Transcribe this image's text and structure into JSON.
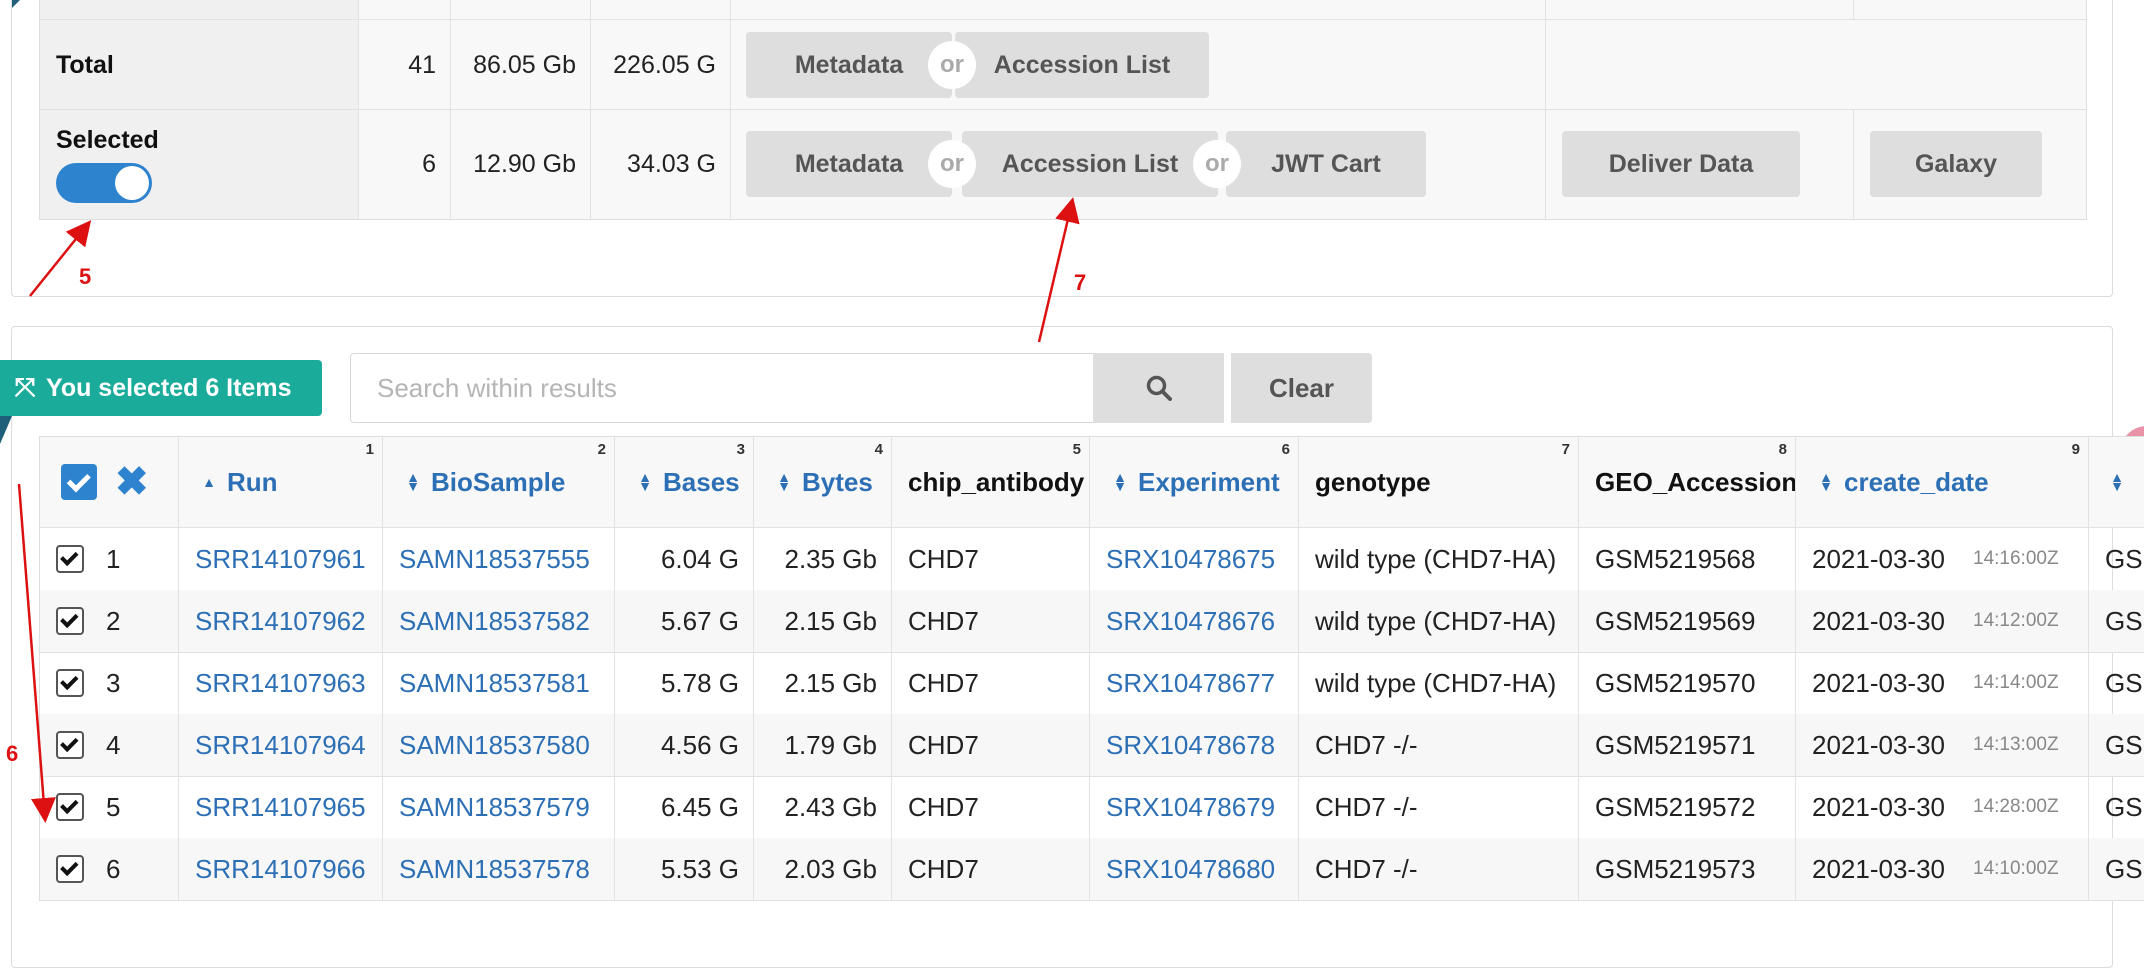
{
  "summary": {
    "total": {
      "label": "Total",
      "runs": "41",
      "bases": "86.05 Gb",
      "bytes": "226.05 G",
      "btn_metadata": "Metadata",
      "or1": "or",
      "btn_accession": "Accession List"
    },
    "selected": {
      "label": "Selected",
      "runs": "6",
      "bases": "12.90 Gb",
      "bytes": "34.03 G",
      "btn_metadata": "Metadata",
      "or1": "or",
      "btn_accession": "Accession List",
      "or2": "or",
      "btn_jwt": "JWT Cart",
      "btn_deliver": "Deliver Data",
      "btn_galaxy": "Galaxy",
      "toggle_on": true
    }
  },
  "annotations": {
    "a5": "5",
    "a6": "6",
    "a7": "7"
  },
  "toolbar": {
    "selected_badge": "You selected 6 Items",
    "search_placeholder": "Search within results",
    "clear_label": "Clear"
  },
  "table": {
    "headers": [
      {
        "label": "Run",
        "num": "1"
      },
      {
        "label": "BioSample",
        "num": "2"
      },
      {
        "label": "Bases",
        "num": "3"
      },
      {
        "label": "Bytes",
        "num": "4"
      },
      {
        "label": "chip_antibody",
        "num": "5"
      },
      {
        "label": "Experiment",
        "num": "6"
      },
      {
        "label": "genotype",
        "num": "7"
      },
      {
        "label": "GEO_Accession",
        "num": "8"
      },
      {
        "label": "create_date",
        "num": "9"
      }
    ],
    "rows": [
      {
        "idx": "1",
        "run": "SRR14107961",
        "biosample": "SAMN18537555",
        "bases": "6.04 G",
        "bytes": "2.35 Gb",
        "antibody": "CHD7",
        "experiment": "SRX10478675",
        "genotype": "wild type (CHD7-HA)",
        "geo": "GSM5219568",
        "date": "2021-03-30",
        "time": "14:16:00Z",
        "extra": "GSM"
      },
      {
        "idx": "2",
        "run": "SRR14107962",
        "biosample": "SAMN18537582",
        "bases": "5.67 G",
        "bytes": "2.15 Gb",
        "antibody": "CHD7",
        "experiment": "SRX10478676",
        "genotype": "wild type (CHD7-HA)",
        "geo": "GSM5219569",
        "date": "2021-03-30",
        "time": "14:12:00Z",
        "extra": "GSM"
      },
      {
        "idx": "3",
        "run": "SRR14107963",
        "biosample": "SAMN18537581",
        "bases": "5.78 G",
        "bytes": "2.15 Gb",
        "antibody": "CHD7",
        "experiment": "SRX10478677",
        "genotype": "wild type (CHD7-HA)",
        "geo": "GSM5219570",
        "date": "2021-03-30",
        "time": "14:14:00Z",
        "extra": "GSM"
      },
      {
        "idx": "4",
        "run": "SRR14107964",
        "biosample": "SAMN18537580",
        "bases": "4.56 G",
        "bytes": "1.79 Gb",
        "antibody": "CHD7",
        "experiment": "SRX10478678",
        "genotype": "CHD7 -/-",
        "geo": "GSM5219571",
        "date": "2021-03-30",
        "time": "14:13:00Z",
        "extra": "GSM"
      },
      {
        "idx": "5",
        "run": "SRR14107965",
        "biosample": "SAMN18537579",
        "bases": "6.45 G",
        "bytes": "2.43 Gb",
        "antibody": "CHD7",
        "experiment": "SRX10478679",
        "genotype": "CHD7 -/-",
        "geo": "GSM5219572",
        "date": "2021-03-30",
        "time": "14:28:00Z",
        "extra": "GSM"
      },
      {
        "idx": "6",
        "run": "SRR14107966",
        "biosample": "SAMN18537578",
        "bases": "5.53 G",
        "bytes": "2.03 Gb",
        "antibody": "CHD7",
        "experiment": "SRX10478680",
        "genotype": "CHD7 -/-",
        "geo": "GSM5219573",
        "date": "2021-03-30",
        "time": "14:10:00Z",
        "extra": "GSM"
      }
    ]
  },
  "colors": {
    "accent": "#2e83cf",
    "badge": "#1bab9a",
    "link": "#2c6fb5",
    "annotation": "#dd1111"
  }
}
